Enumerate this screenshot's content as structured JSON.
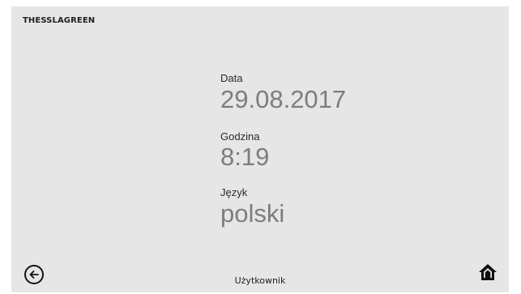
{
  "brand": "THESSLAGREEN",
  "settings": {
    "date": {
      "label": "Data",
      "value": "29.08.2017"
    },
    "time": {
      "label": "Godzina",
      "value": "8:19"
    },
    "language": {
      "label": "Język",
      "value": "polski"
    }
  },
  "footer": {
    "title": "Użytkownik",
    "back_icon": "arrow-left-circle-icon",
    "home_icon": "home-icon"
  },
  "colors": {
    "background": "#e6e6e6",
    "value_text": "#7d7d7d",
    "label_text": "#2a2a2a"
  }
}
